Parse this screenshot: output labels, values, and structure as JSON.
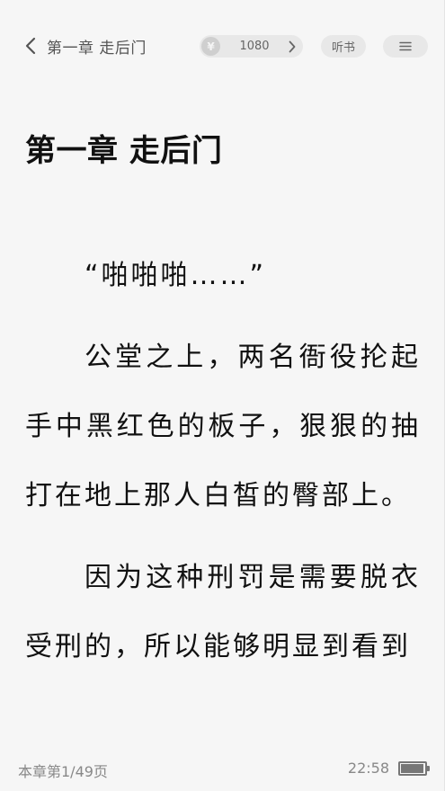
{
  "topbar": {
    "back_label": "第一章 走后门",
    "coin_symbol": "¥",
    "coin_balance": "1080",
    "listen_label": "听书"
  },
  "chapter": {
    "title": "第一章 走后门",
    "paragraphs": [
      "“啪啪啪……”",
      "公堂之上，两名衙役抡起手中黑红色的板子，狠狠的抽打在地上那人白皙的臀部上。",
      "因为这种刑罚是需要脱衣受刑的，所以能够明显到看到"
    ]
  },
  "footer": {
    "page_indicator": "本章第1/49页",
    "time": "22:58",
    "battery_level": 0.95
  },
  "icons": {
    "back": "chevron-left-icon",
    "coin": "yuan-coin-icon",
    "coin_arrow": "chevron-right-icon",
    "menu": "menu-icon",
    "battery": "battery-icon"
  },
  "colors": {
    "background": "#f6f6f6",
    "pill": "#e8e8e8",
    "text": "#111111",
    "muted": "#888888"
  }
}
